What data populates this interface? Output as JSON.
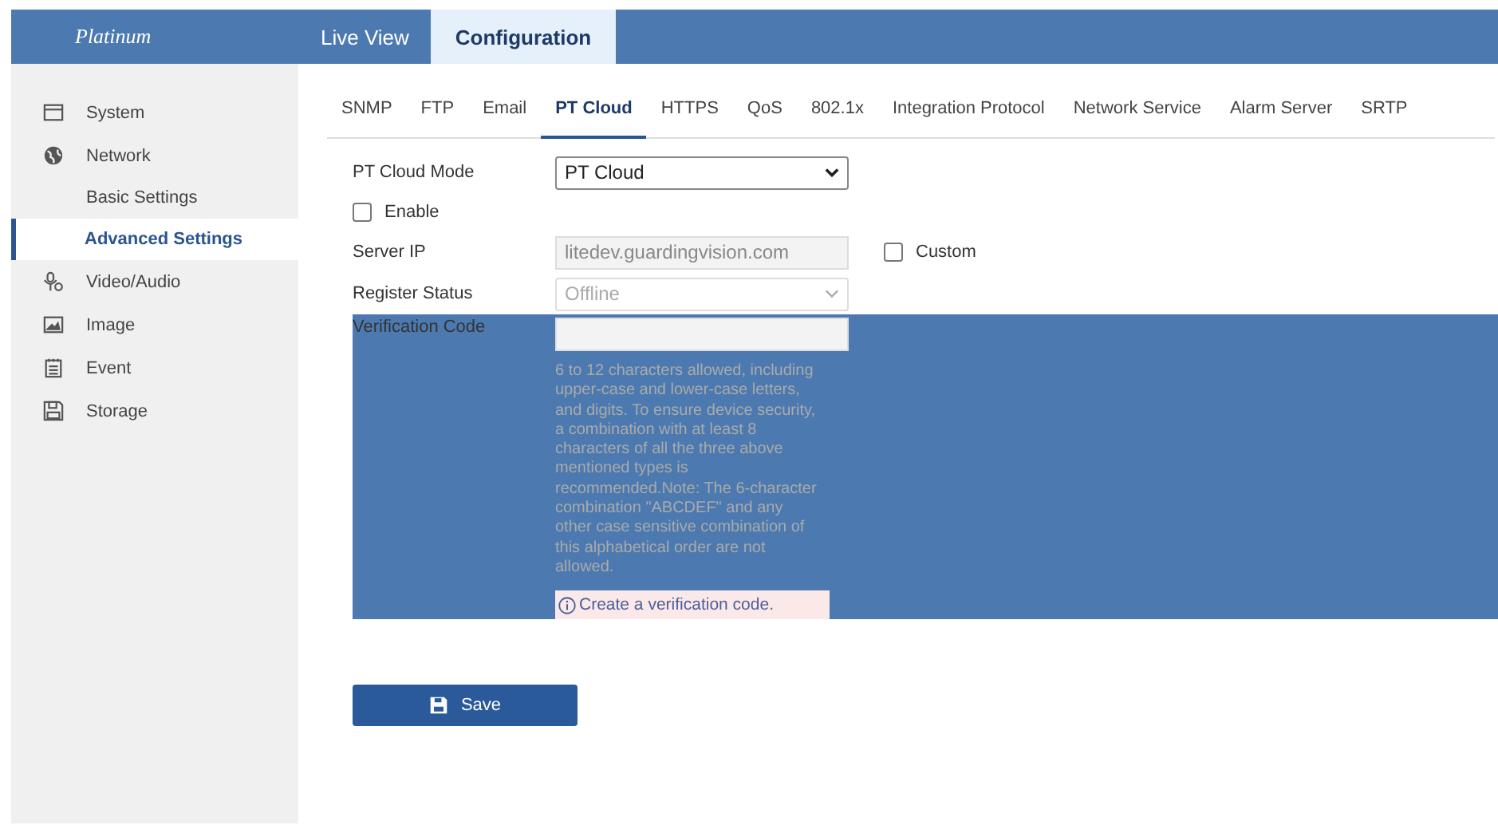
{
  "header": {
    "logo": "Platinum",
    "tabs": [
      {
        "label": "Live View",
        "selected": false
      },
      {
        "label": "Configuration",
        "selected": true
      }
    ]
  },
  "sidebar": {
    "items": [
      {
        "label": "System",
        "kind": "system"
      },
      {
        "label": "Network",
        "kind": "network",
        "children": [
          {
            "label": "Basic Settings",
            "selected": false
          },
          {
            "label": "Advanced Settings",
            "selected": true
          }
        ]
      },
      {
        "label": "Video/Audio",
        "kind": "video"
      },
      {
        "label": "Image",
        "kind": "image"
      },
      {
        "label": "Event",
        "kind": "event"
      },
      {
        "label": "Storage",
        "kind": "storage"
      }
    ]
  },
  "subtabs": [
    {
      "label": "SNMP",
      "selected": false
    },
    {
      "label": "FTP",
      "selected": false
    },
    {
      "label": "Email",
      "selected": false
    },
    {
      "label": "PT Cloud",
      "selected": true
    },
    {
      "label": "HTTPS",
      "selected": false
    },
    {
      "label": "QoS",
      "selected": false
    },
    {
      "label": "802.1x",
      "selected": false
    },
    {
      "label": "Integration Protocol",
      "selected": false
    },
    {
      "label": "Network Service",
      "selected": false
    },
    {
      "label": "Alarm Server",
      "selected": false
    },
    {
      "label": "SRTP",
      "selected": false
    }
  ],
  "form": {
    "mode": {
      "label": "PT Cloud Mode",
      "value": "PT Cloud"
    },
    "enable": {
      "label": "Enable",
      "checked": false
    },
    "server_ip": {
      "label": "Server IP",
      "value": "litedev.guardingvision.com",
      "disabled": true,
      "custom": {
        "label": "Custom",
        "checked": false
      }
    },
    "register_status": {
      "label": "Register Status",
      "value": "Offline",
      "disabled": true
    },
    "verification_code": {
      "label": "Verification Code",
      "hint": "6 to 12 characters allowed, including upper-case and lower-case letters, and digits. To ensure device security, a combination with at least 8 characters of all the three above mentioned types is recommended.Note: The 6-character combination \"ABCDEF\" and any other case sensitive combination of this alphabetical order are not allowed.",
      "tip": "Create a verification code."
    }
  },
  "save_button": "Save"
}
